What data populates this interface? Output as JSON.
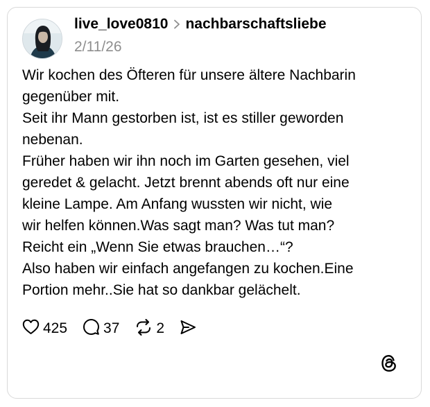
{
  "post": {
    "username": "live_love0810",
    "community": "nachbarschaftsliebe",
    "date": "2/11/26",
    "lines": [
      "Wir kochen des Öfteren für unsere ältere Nachbarin",
      "gegenüber mit.",
      "Seit ihr Mann gestorben ist, ist es stiller geworden",
      "nebenan.",
      "Früher haben wir ihn noch im Garten gesehen, viel",
      "geredet & gelacht. Jetzt brennt abends oft nur eine",
      "kleine Lampe. Am Anfang wussten wir nicht, wie",
      "wir helfen können.Was sagt man? Was tut man?",
      "Reicht ein „Wenn Sie etwas brauchen…“?",
      "Also haben wir einfach angefangen zu kochen.Eine",
      "Portion mehr..Sie hat so dankbar gelächelt."
    ]
  },
  "actions": {
    "likes": "425",
    "replies": "37",
    "reposts": "2"
  },
  "icons": {
    "separator": "chevron-right-icon",
    "like": "heart-icon",
    "reply": "comment-bubble-icon",
    "repost": "repost-arrows-icon",
    "share": "send-icon",
    "brand": "threads-logo-icon"
  },
  "colors": {
    "text": "#000000",
    "secondary_text": "#8e8e8e",
    "border": "#d9d9d9"
  }
}
